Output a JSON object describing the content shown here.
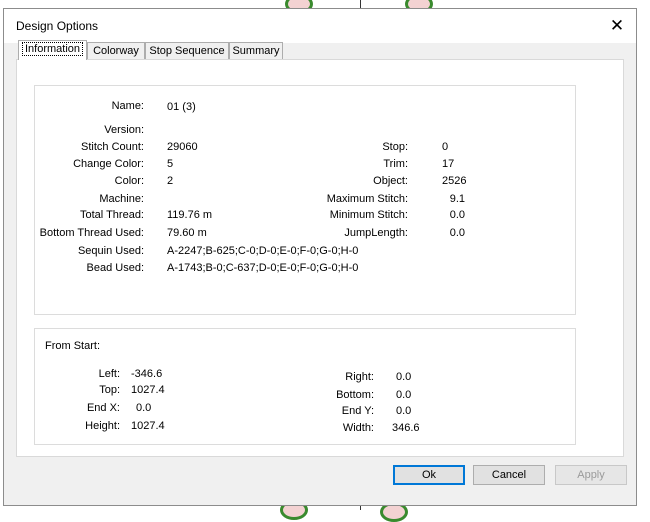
{
  "dialog": {
    "title": "Design Options",
    "close_glyph": "✕"
  },
  "tabs": [
    {
      "label": "Information",
      "active": true
    },
    {
      "label": "Colorway",
      "active": false
    },
    {
      "label": "Stop Sequence",
      "active": false
    },
    {
      "label": "Summary",
      "active": false
    }
  ],
  "info": {
    "name": {
      "label": "Name:",
      "value": "01 (3)"
    },
    "version": {
      "label": "Version:",
      "value": ""
    },
    "stitch_count": {
      "label": "Stitch Count:",
      "value": "29060"
    },
    "change_color": {
      "label": "Change Color:",
      "value": "5"
    },
    "color": {
      "label": "Color:",
      "value": "2"
    },
    "machine": {
      "label": "Machine:",
      "value": ""
    },
    "total_thread": {
      "label": "Total Thread:",
      "value": "119.76 m"
    },
    "bottom_thread_used": {
      "label": "Bottom Thread Used:",
      "value": "79.60 m"
    },
    "sequin_used": {
      "label": "Sequin Used:",
      "value": "A-2247;B-625;C-0;D-0;E-0;F-0;G-0;H-0"
    },
    "bead_used": {
      "label": "Bead Used:",
      "value": "A-1743;B-0;C-637;D-0;E-0;F-0;G-0;H-0"
    },
    "stop": {
      "label": "Stop:",
      "value": "0"
    },
    "trim": {
      "label": "Trim:",
      "value": "17"
    },
    "object": {
      "label": "Object:",
      "value": "2526"
    },
    "maximum_stitch": {
      "label": "Maximum Stitch:",
      "value": "9.1"
    },
    "minimum_stitch": {
      "label": "Minimum Stitch:",
      "value": "0.0"
    },
    "jump_length": {
      "label": "JumpLength:",
      "value": "0.0"
    }
  },
  "from_start": {
    "heading": "From Start:",
    "left": {
      "label": "Left:",
      "value": "-346.6"
    },
    "top": {
      "label": "Top:",
      "value": "1027.4"
    },
    "end_x": {
      "label": "End X:",
      "value": "0.0"
    },
    "height": {
      "label": "Height:",
      "value": "1027.4"
    },
    "right": {
      "label": "Right:",
      "value": "0.0"
    },
    "bottom": {
      "label": "Bottom:",
      "value": "0.0"
    },
    "end_y": {
      "label": "End Y:",
      "value": "0.0"
    },
    "width": {
      "label": "Width:",
      "value": "346.6"
    }
  },
  "buttons": {
    "ok": "Ok",
    "cancel": "Cancel",
    "apply": "Apply"
  }
}
